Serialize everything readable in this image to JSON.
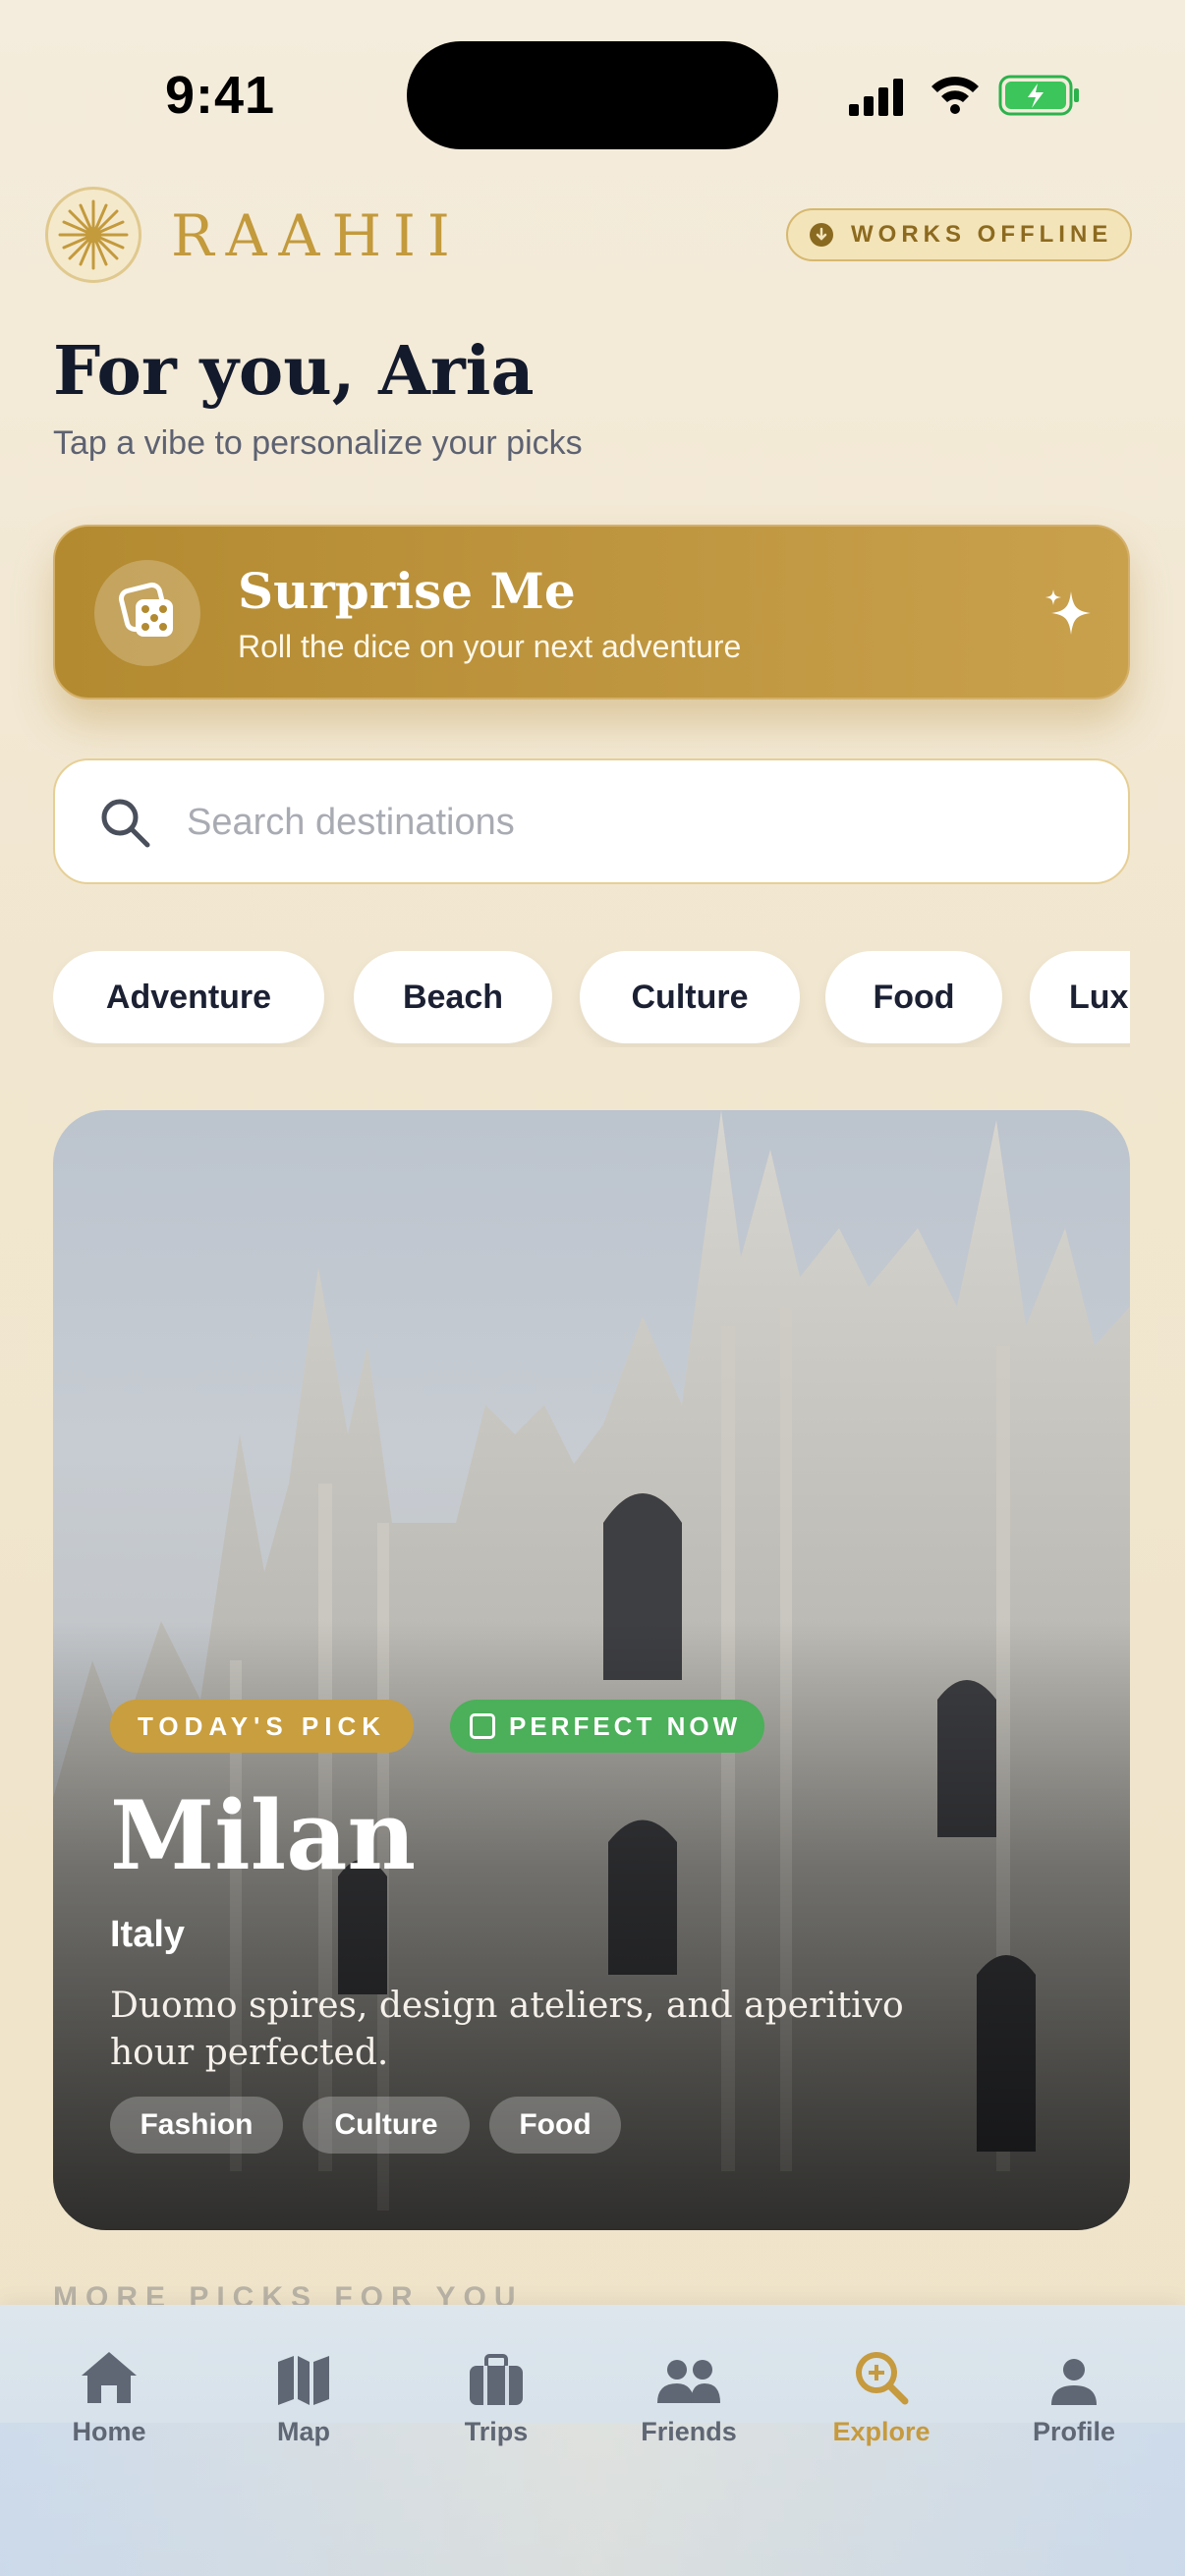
{
  "status_bar": {
    "time": "9:41"
  },
  "header": {
    "brand": "RAAHII",
    "offline_badge": "WORKS OFFLINE",
    "title": "For you, Aria",
    "subtitle": "Tap a vibe to personalize your picks"
  },
  "surprise": {
    "title": "Surprise Me",
    "subtitle": "Roll the dice on your next adventure"
  },
  "search": {
    "placeholder": "Search destinations",
    "value": ""
  },
  "vibes": [
    "Adventure",
    "Beach",
    "Culture",
    "Food",
    "Luxury"
  ],
  "featured": {
    "badge_pick": "TODAY'S PICK",
    "badge_now": "PERFECT NOW",
    "city": "Milan",
    "country": "Italy",
    "description": "Duomo spires, design ateliers, and aperitivo hour perfected.",
    "tags": [
      "Fashion",
      "Culture",
      "Food"
    ]
  },
  "section_peek": "MORE PICKS FOR YOU",
  "tabs": [
    {
      "label": "Home",
      "icon": "home-icon"
    },
    {
      "label": "Map",
      "icon": "map-icon"
    },
    {
      "label": "Trips",
      "icon": "briefcase-icon"
    },
    {
      "label": "Friends",
      "icon": "friends-icon"
    },
    {
      "label": "Explore",
      "icon": "explore-icon",
      "active": true
    },
    {
      "label": "Profile",
      "icon": "profile-icon"
    }
  ],
  "colors": {
    "accent": "#c69a3e",
    "success": "#4caf5a",
    "ink": "#131a2c"
  }
}
